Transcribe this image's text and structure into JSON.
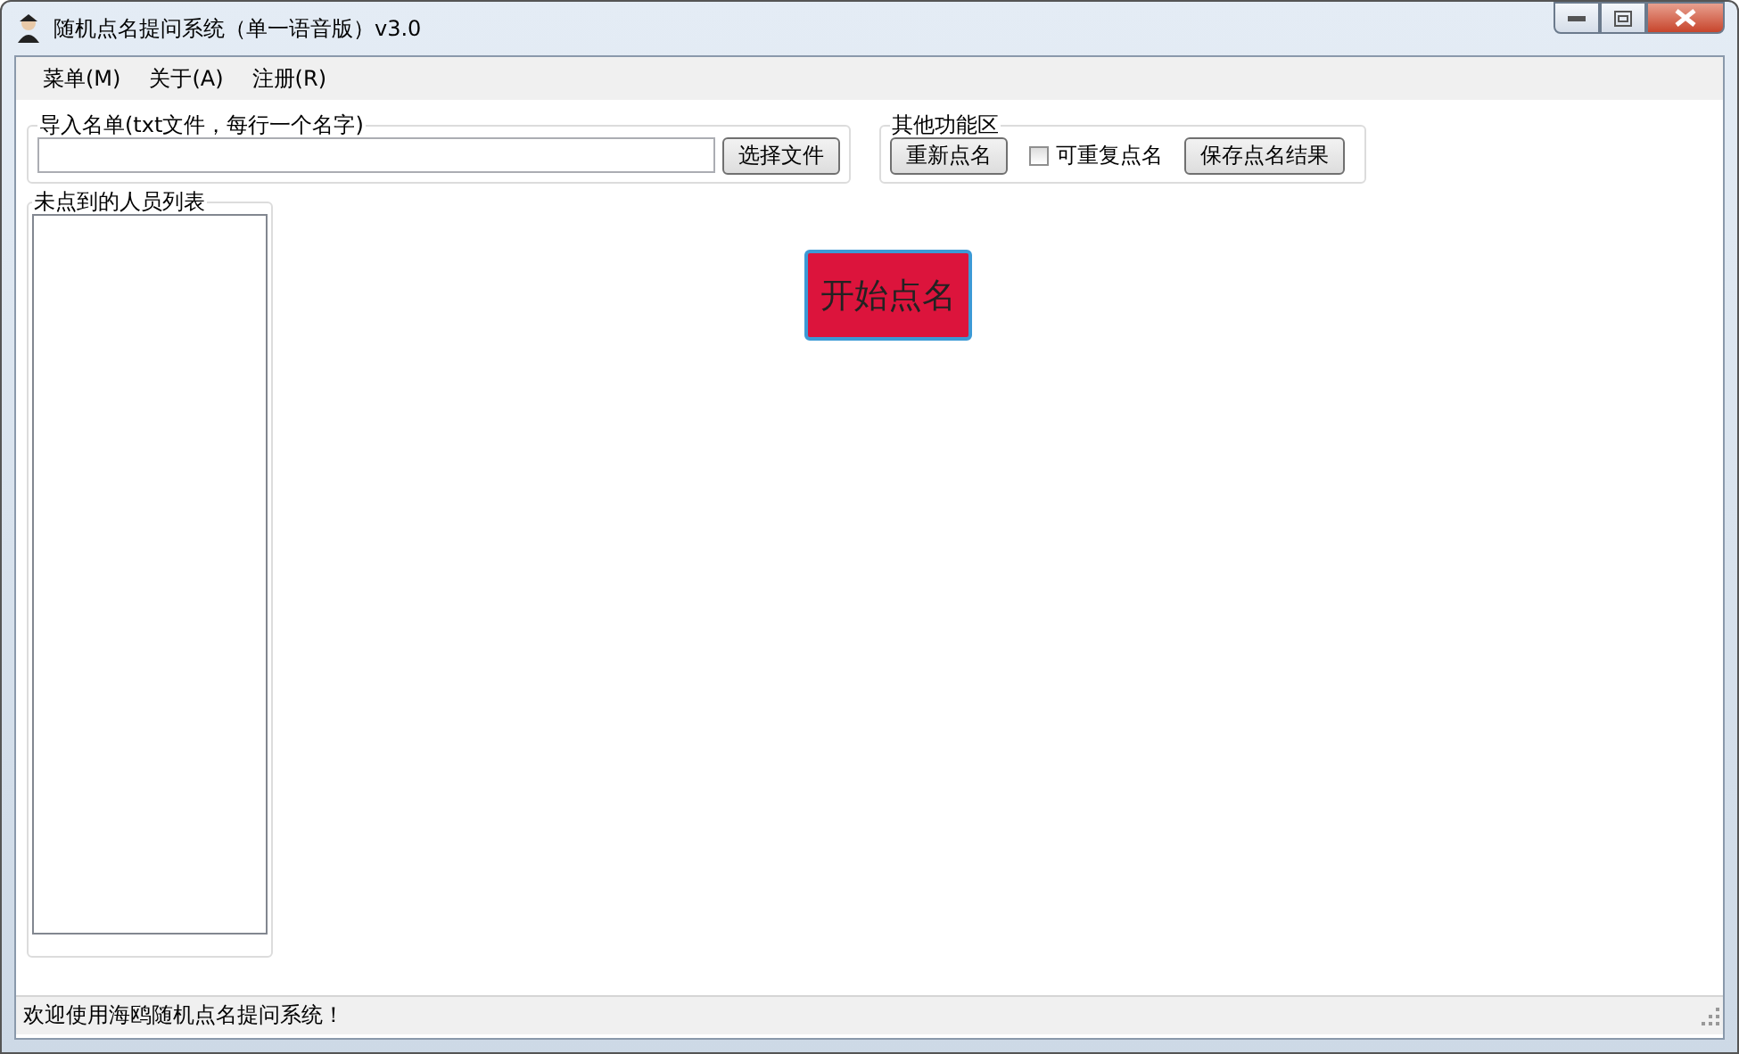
{
  "window": {
    "title": "随机点名提问系统（单一语音版）v3.0"
  },
  "menu": [
    {
      "label": "菜单(M)"
    },
    {
      "label": "关于(A)"
    },
    {
      "label": "注册(R)"
    }
  ],
  "import_group": {
    "title": "导入名单(txt文件，每行一个名字)",
    "button": "选择文件"
  },
  "other_group": {
    "title": "其他功能区",
    "reset_button": "重新点名",
    "repeat_checkbox": {
      "label": "可重复点名",
      "checked": false
    },
    "save_button": "保存点名结果"
  },
  "list_group": {
    "title": "未点到的人员列表"
  },
  "start_button": "开始点名",
  "status_bar": "欢迎使用海鸥随机点名提问系统！"
}
